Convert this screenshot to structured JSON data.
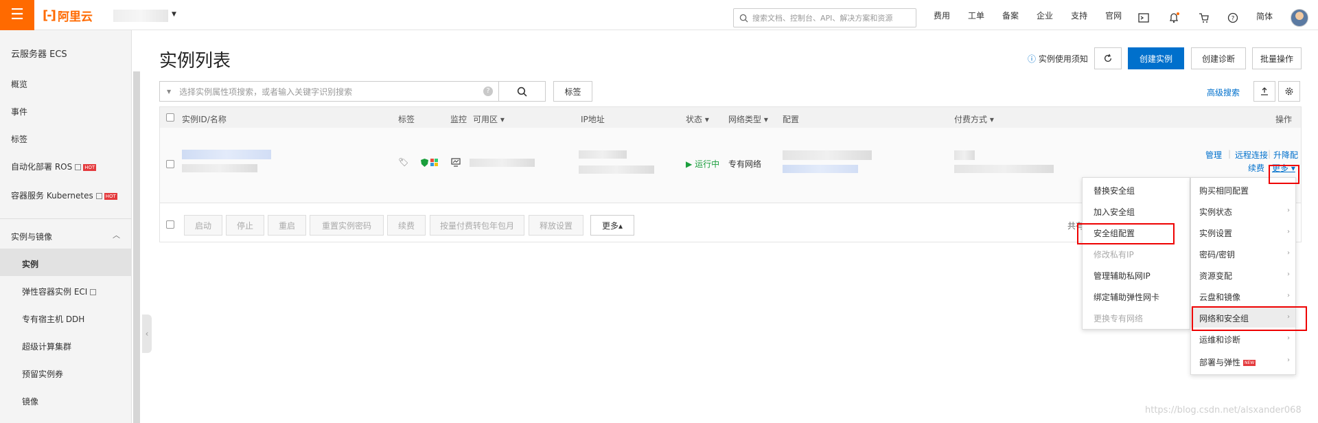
{
  "topbar": {
    "menu_icon": "hamburger-icon",
    "logo_text": "阿里云",
    "search_placeholder": "搜索文档、控制台、API、解决方案和资源",
    "nav": [
      "费用",
      "工单",
      "备案",
      "企业",
      "支持",
      "官网"
    ],
    "lang": "简体"
  },
  "sidebar": {
    "title": "云服务器 ECS",
    "items": [
      {
        "label": "概览"
      },
      {
        "label": "事件"
      },
      {
        "label": "标签"
      },
      {
        "label": "自动化部署 ROS",
        "badge": "HOT"
      },
      {
        "label": "容器服务 Kubernetes",
        "badge": "HOT"
      }
    ],
    "section": "实例与镜像",
    "sub_items": [
      {
        "label": "实例"
      },
      {
        "label": "弹性容器实例 ECI"
      },
      {
        "label": "专有宿主机 DDH"
      },
      {
        "label": "超级计算集群"
      },
      {
        "label": "预留实例券"
      },
      {
        "label": "镜像"
      }
    ]
  },
  "main": {
    "title": "实例列表",
    "notice": "实例使用须知",
    "buttons": {
      "create": "创建实例",
      "diagnose": "创建诊断",
      "batch": "批量操作"
    },
    "filter_placeholder": "选择实例属性项搜索，或者输入关键字识别搜索",
    "tag_button": "标签",
    "advanced_search": "高级搜索",
    "columns": [
      "实例ID/名称",
      "标签",
      "监控",
      "可用区",
      "IP地址",
      "状态",
      "网络类型",
      "配置",
      "付费方式",
      "操作"
    ],
    "row": {
      "status": "运行中",
      "network": "专有网络",
      "actions": {
        "manage": "管理",
        "remote": "远程连接",
        "upgrade": "升降配",
        "renew": "续费",
        "more": "更多"
      }
    },
    "footer_buttons": [
      "启动",
      "停止",
      "重启",
      "重置实例密码",
      "续费",
      "按量付费转包年包月",
      "释放设置",
      "更多▴"
    ],
    "footer_total": "共有"
  },
  "dropdown_left": [
    {
      "label": "替换安全组",
      "disabled": false
    },
    {
      "label": "加入安全组",
      "disabled": false
    },
    {
      "label": "安全组配置",
      "disabled": false
    },
    {
      "label": "修改私有IP",
      "disabled": true
    },
    {
      "label": "管理辅助私网IP",
      "disabled": false
    },
    {
      "label": "绑定辅助弹性网卡",
      "disabled": false
    },
    {
      "label": "更换专有网络",
      "disabled": true
    }
  ],
  "dropdown_right": [
    {
      "label": "购买相同配置"
    },
    {
      "label": "实例状态"
    },
    {
      "label": "实例设置"
    },
    {
      "label": "密码/密钥"
    },
    {
      "label": "资源变配"
    },
    {
      "label": "云盘和镜像"
    },
    {
      "label": "网络和安全组"
    },
    {
      "label": "运维和诊断"
    },
    {
      "label": "部署与弹性",
      "badge": "NEW"
    }
  ],
  "watermark": "https://blog.csdn.net/alsxander068",
  "colors": {
    "accent": "#ff6a00",
    "primary": "#0070cc",
    "highlight": "#e00000"
  }
}
